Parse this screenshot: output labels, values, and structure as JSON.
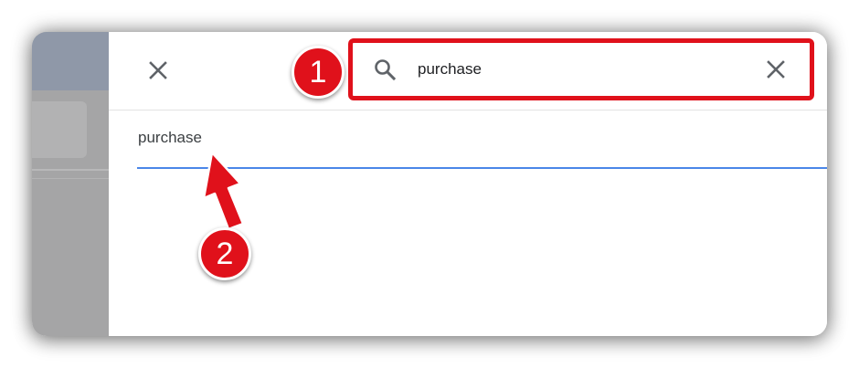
{
  "search": {
    "value": "purchase",
    "placeholder": ""
  },
  "results": [
    {
      "label": "purchase"
    }
  ],
  "callouts": {
    "one": "1",
    "two": "2"
  },
  "icons": {
    "close": "close-icon",
    "search": "search-icon",
    "clear": "clear-icon"
  },
  "colors": {
    "annotation_red": "#e0111b",
    "accent_blue": "#4a86e8",
    "icon_gray": "#5f6368"
  }
}
